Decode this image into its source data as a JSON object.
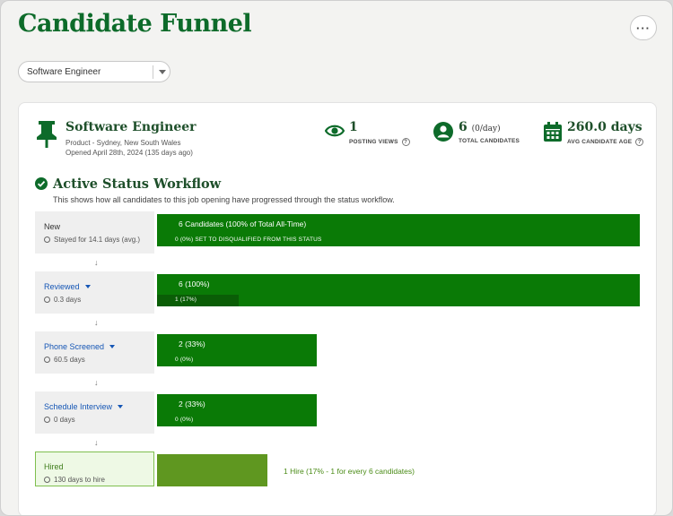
{
  "page": {
    "title": "Candidate Funnel",
    "more_label": "···"
  },
  "job_select": {
    "value": "Software Engineer"
  },
  "job": {
    "title": "Software Engineer",
    "location": "Product - Sydney, New South Wales",
    "opened": "Opened April 28th, 2024 (135 days ago)"
  },
  "stats": {
    "views": {
      "value": "1",
      "label": "POSTING VIEWS"
    },
    "candidates": {
      "value": "6",
      "extra": "(0/day)",
      "label": "TOTAL CANDIDATES"
    },
    "age": {
      "value": "260.0 days",
      "label": "AVG CANDIDATE AGE"
    }
  },
  "workflow": {
    "title": "Active Status Workflow",
    "description": "This shows how all candidates to this job opening have progressed through the status workflow.",
    "arrow": "↓",
    "stages": [
      {
        "name": "New",
        "meta": "Stayed for 14.1 days (avg.)",
        "bar_label": "6 Candidates (100% of Total All-Time)",
        "sub_label": "0 (0%) SET TO DISQUALIFIED FROM THIS STATUS",
        "fraction": 1.0,
        "sub_fraction": 0
      },
      {
        "name": "Reviewed",
        "meta": "0.3 days",
        "bar_label": "6 (100%)",
        "sub_label": "1 (17%)",
        "fraction": 1.0,
        "sub_fraction": 0.17
      },
      {
        "name": "Phone Screened",
        "meta": "60.5 days",
        "bar_label": "2 (33%)",
        "sub_label": "0 (0%)",
        "fraction": 0.33,
        "sub_fraction": 0
      },
      {
        "name": "Schedule Interview",
        "meta": "0 days",
        "bar_label": "2 (33%)",
        "sub_label": "0 (0%)",
        "fraction": 0.33,
        "sub_fraction": 0
      }
    ],
    "hired": {
      "name": "Hired",
      "meta": "130 days to hire",
      "summary": "1 Hire (17% - 1 for every 6 candidates)",
      "fraction": 0.17
    }
  },
  "colors": {
    "brand": "#0d6b2a",
    "bar": "#0a7a06",
    "bar_dark": "#0a5d06",
    "hire": "#5f9720",
    "link": "#1556b5"
  }
}
